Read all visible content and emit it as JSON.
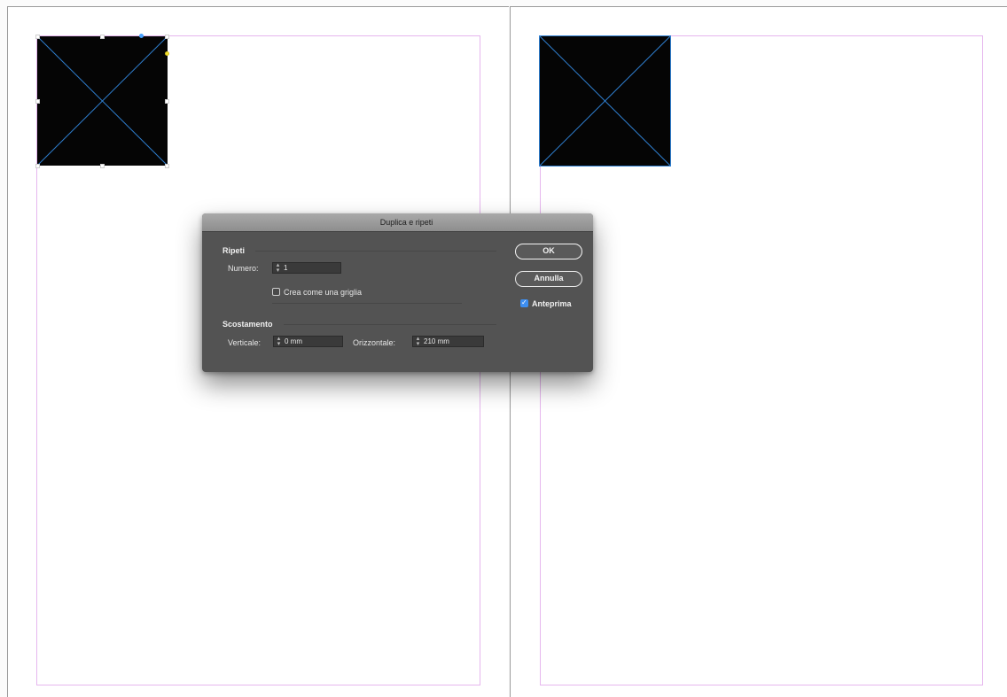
{
  "dialog": {
    "title": "Duplica e ripeti",
    "repeat_section": "Ripeti",
    "count_label": "Numero:",
    "count_value": "1",
    "grid_label": "Crea come una griglia",
    "grid_checked": false,
    "offset_section": "Scostamento",
    "vertical_label": "Verticale:",
    "vertical_value": "0 mm",
    "horizontal_label": "Orizzontale:",
    "horizontal_value": "210 mm",
    "ok_label": "OK",
    "cancel_label": "Annulla",
    "preview_label": "Anteprima",
    "preview_checked": true
  },
  "colors": {
    "margin_guide": "#e6b6ee",
    "frame_fill": "#050505",
    "frame_cross": "#2f7fd0",
    "dialog_bg": "#535353"
  }
}
